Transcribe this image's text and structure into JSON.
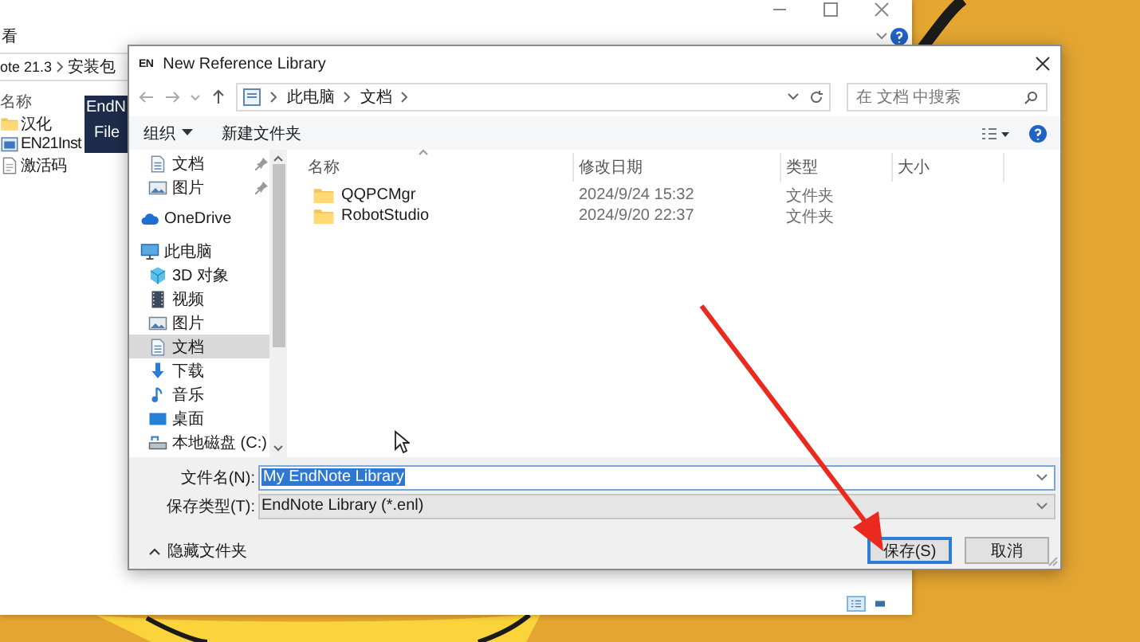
{
  "background_window": {
    "menu_label": "看",
    "path": [
      "ote 21.3",
      "安装包"
    ],
    "column": "名称",
    "items": [
      {
        "name": "汉化",
        "kind": "folder"
      },
      {
        "name": "EN21Inst",
        "kind": "installer"
      },
      {
        "name": "激活码",
        "kind": "file"
      }
    ],
    "view_buttons": [
      {
        "kind": "details",
        "selected": true
      },
      {
        "kind": "large_icons",
        "selected": false
      }
    ]
  },
  "endnote_window": {
    "title": "EndN",
    "menu": "File"
  },
  "dialog": {
    "icon_text": "EN",
    "title": "New Reference Library",
    "path": [
      "此电脑",
      "文档"
    ],
    "search": {
      "placeholder": "在 文档 中搜索"
    },
    "toolbar": [
      {
        "label": "组织",
        "dropdown": true
      },
      {
        "label": "新建文件夹",
        "dropdown": false
      }
    ],
    "nav": [
      {
        "label": "文档",
        "kind": "documents",
        "pinned": true,
        "selected": false
      },
      {
        "label": "图片",
        "kind": "pictures",
        "pinned": true,
        "selected": false
      },
      {
        "label": "OneDrive",
        "kind": "cloud",
        "pinned": false,
        "selected": false
      },
      {
        "label": "此电脑",
        "kind": "computer",
        "pinned": false,
        "selected": false,
        "children": [
          {
            "label": "3D 对象",
            "kind": "cube",
            "pinned": false,
            "selected": false
          },
          {
            "label": "视频",
            "kind": "video",
            "pinned": false,
            "selected": false
          },
          {
            "label": "图片",
            "kind": "pictures",
            "pinned": false,
            "selected": false
          },
          {
            "label": "文档",
            "kind": "documents",
            "pinned": false,
            "selected": true
          },
          {
            "label": "下载",
            "kind": "download",
            "pinned": false,
            "selected": false
          },
          {
            "label": "音乐",
            "kind": "music",
            "pinned": false,
            "selected": false
          },
          {
            "label": "桌面",
            "kind": "desktop",
            "pinned": false,
            "selected": false
          },
          {
            "label": "本地磁盘 (C:)",
            "kind": "drive",
            "pinned": false,
            "selected": false
          }
        ]
      }
    ],
    "columns": [
      "名称",
      "修改日期",
      "类型",
      "大小"
    ],
    "rows": [
      {
        "name": "QQPCMgr",
        "modified": "2024/9/24 15:32",
        "type": "文件夹"
      },
      {
        "name": "RobotStudio",
        "modified": "2024/9/20 22:37",
        "type": "文件夹"
      }
    ],
    "file_name": {
      "label": "文件名(N):",
      "value": "My EndNote Library",
      "text_selected": true
    },
    "file_type": {
      "label": "保存类型(T):",
      "value": "EndNote Library (*.enl)"
    },
    "hide_folders": "隐藏文件夹",
    "buttons": [
      {
        "label": "保存(S)",
        "default": true
      },
      {
        "label": "取消",
        "default": false
      }
    ]
  }
}
